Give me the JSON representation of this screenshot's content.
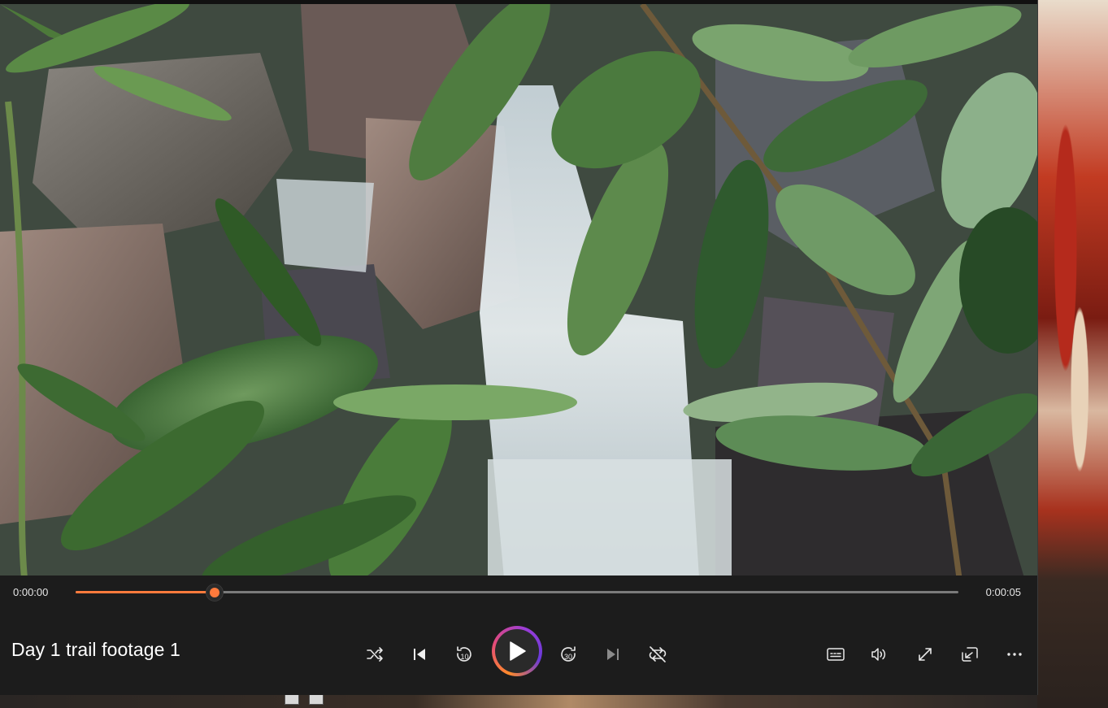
{
  "player": {
    "title": "Day 1 trail footage 1",
    "time_elapsed": "0:00:00",
    "time_total": "0:00:05",
    "progress_fraction": 0.157,
    "accent_color": "#ff7a3c"
  },
  "controls": {
    "shuffle_icon": "shuffle-icon",
    "previous_icon": "skip-previous-icon",
    "rewind_label": "10",
    "play_icon": "play-icon",
    "forward_label": "30",
    "next_icon": "skip-next-icon",
    "repeat_icon": "repeat-icon",
    "captions_icon": "captions-icon",
    "volume_icon": "volume-icon",
    "fullscreen_icon": "fullscreen-icon",
    "miniplayer_icon": "miniplayer-icon",
    "more_icon": "more-options-icon"
  }
}
